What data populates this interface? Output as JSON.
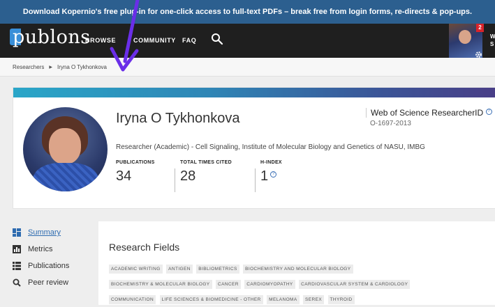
{
  "banner": {
    "text": "Download Kopernio's free plug-in for one-click access to full-text PDFs – break free from login forms, re-directs & pop-ups."
  },
  "nav": {
    "logo": "publons",
    "browse": "BROWSE",
    "community": "COMMUNITY",
    "faq": "FAQ",
    "search_icon": "search-icon",
    "notification_count": "2",
    "username_fragment": "W\nS"
  },
  "breadcrumb": {
    "root": "Researchers",
    "current": "Iryna O Tykhonkova"
  },
  "profile": {
    "name": "Iryna O Tykhonkova",
    "researcher_id_label": "Web of Science ResearcherID",
    "researcher_id": "O-1697-2013",
    "role": "Researcher (Academic) - Cell Signaling, Institute of Molecular Biology and Genetics of NASU, IMBG",
    "metrics": [
      {
        "label": "PUBLICATIONS",
        "value": "34"
      },
      {
        "label": "TOTAL TIMES CITED",
        "value": "28"
      },
      {
        "label": "H-INDEX",
        "value": "1"
      }
    ]
  },
  "sidebar": {
    "items": [
      {
        "label": "Summary",
        "icon": "dashboard-icon",
        "active": true
      },
      {
        "label": "Metrics",
        "icon": "bar-chart-icon",
        "active": false
      },
      {
        "label": "Publications",
        "icon": "list-icon",
        "active": false
      },
      {
        "label": "Peer review",
        "icon": "magnifier-icon",
        "active": false
      }
    ]
  },
  "research_fields": {
    "title": "Research Fields",
    "tags": [
      "ACADEMIC WRITING",
      "ANTIGEN",
      "BIBLIOMETRICS",
      "BIOCHEMISTRY AND MOLECULAR BIOLOGY",
      "BIOCHEMISTRY & MOLECULAR BIOLOGY",
      "CANCER",
      "CARDIOMYOPATHY",
      "CARDIOVASCULAR SYSTEM & CARDIOLOGY",
      "COMMUNICATION",
      "LIFE SCIENCES & BIOMEDICINE - OTHER",
      "MELANOMA",
      "SEREX",
      "THYROID"
    ]
  },
  "colors": {
    "banner_bg": "#2c5f8f",
    "nav_bg": "#1f1f1f",
    "link": "#2d6bb0",
    "annotation_arrow": "#6a2ee8",
    "notification": "#d9232a"
  }
}
